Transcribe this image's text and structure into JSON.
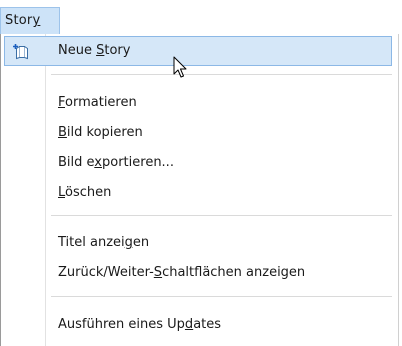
{
  "menu": {
    "title": "Story"
  },
  "items": [
    {
      "pre": "Neue ",
      "mn": "S",
      "post": "tory"
    },
    {
      "pre": "",
      "mn": "F",
      "post": "ormatieren"
    },
    {
      "pre": "",
      "mn": "B",
      "post": "ild kopieren"
    },
    {
      "pre": "Bild e",
      "mn": "x",
      "post": "portieren..."
    },
    {
      "pre": "",
      "mn": "L",
      "post": "öschen"
    },
    {
      "pre": "Titel anzei",
      "mn": "g",
      "post": "en"
    },
    {
      "pre": "Zurück/Weiter-",
      "mn": "S",
      "post": "chaltflächen anzeigen"
    },
    {
      "pre": "Ausführen eines Up",
      "mn": "d",
      "post": "ates"
    }
  ],
  "icons": {
    "new_story": "new-story-icon",
    "cursor": "mouse-pointer-icon"
  },
  "colors": {
    "highlight_bg": "#d5e7f8",
    "highlight_border": "#8cb8e6",
    "menu_title_bg": "#cde3f8"
  }
}
